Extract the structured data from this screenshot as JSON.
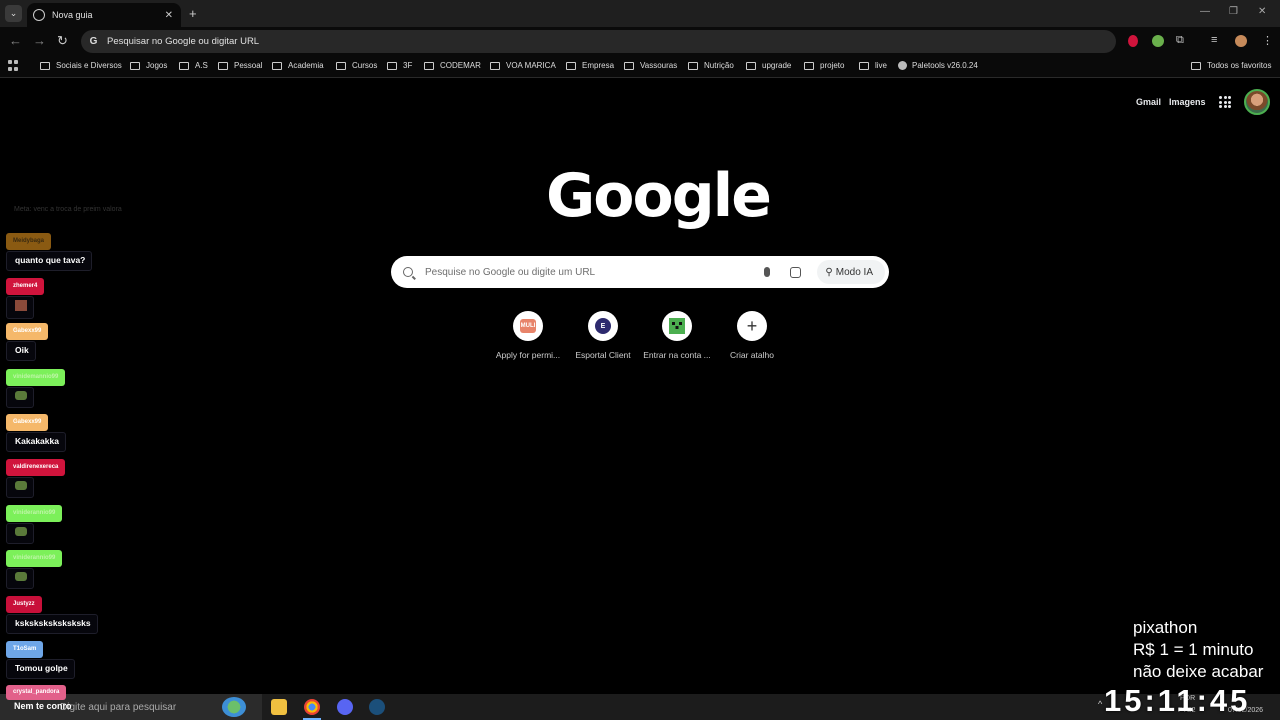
{
  "tab": {
    "title": "Nova guia",
    "close": "✕",
    "new": "+"
  },
  "window": {
    "minimize": "—",
    "restore": "❐",
    "close": "✕"
  },
  "toolbar": {
    "back": "←",
    "forward": "→",
    "reload": "↻",
    "omnibox_text": "Pesquisar no Google ou digitar URL",
    "menu": "⋮"
  },
  "bookmarks": {
    "items": [
      {
        "label": "Sociais e Diversos",
        "type": "folder"
      },
      {
        "label": "Jogos",
        "type": "folder"
      },
      {
        "label": "A.S",
        "type": "folder"
      },
      {
        "label": "Pessoal",
        "type": "folder"
      },
      {
        "label": "Academia",
        "type": "folder"
      },
      {
        "label": "Cursos",
        "type": "folder"
      },
      {
        "label": "3F",
        "type": "folder"
      },
      {
        "label": "CODEMAR",
        "type": "folder"
      },
      {
        "label": "VOA MARICA",
        "type": "folder"
      },
      {
        "label": "Empresa",
        "type": "folder"
      },
      {
        "label": "Vassouras",
        "type": "folder"
      },
      {
        "label": "Nutrição",
        "type": "folder"
      },
      {
        "label": "upgrade",
        "type": "folder"
      },
      {
        "label": "projeto",
        "type": "folder"
      },
      {
        "label": "live",
        "type": "folder"
      },
      {
        "label": "Paletools v26.0.24",
        "type": "site"
      }
    ],
    "all": "Todos os favoritos"
  },
  "header": {
    "gmail": "Gmail",
    "images": "Imagens"
  },
  "logo": "Google",
  "search": {
    "placeholder": "Pesquise no Google ou digite um URL",
    "ai_mode": "Modo IA"
  },
  "shortcuts": [
    {
      "label": "Apply for permi...",
      "icon": "muli-icon",
      "text": "MULI"
    },
    {
      "label": "Esportal Client",
      "icon": "esportal-icon",
      "text": "E"
    },
    {
      "label": "Entrar na conta ...",
      "icon": "creeper-icon",
      "text": ""
    },
    {
      "label": "Criar atalho",
      "icon": "plus-icon",
      "text": "+"
    }
  ],
  "chat": {
    "top_text": "Meta: venc a troca de preim valora",
    "messages": [
      {
        "user": "Meidybaga",
        "color": "#8a5a12",
        "text": "quanto que tava?"
      },
      {
        "user": "zhemer4",
        "color": "#d0143c",
        "text": ""
      },
      {
        "user": "Gabexx99",
        "color": "#f5b86a",
        "text": "Oik"
      },
      {
        "user": "vinidemannio99",
        "color": "#7cf05a",
        "text": ""
      },
      {
        "user": "Gabexx99",
        "color": "#f5b86a",
        "text": "Kakakakka"
      },
      {
        "user": "valdirenexereca",
        "color": "#d0143c",
        "text": ""
      },
      {
        "user": "viniderannio99",
        "color": "#7cf05a",
        "text": ""
      },
      {
        "user": "viniderannio99",
        "color": "#7cf05a",
        "text": ""
      },
      {
        "user": "Justyzz",
        "color": "#c8103a",
        "text": "ksksksksksksksks"
      },
      {
        "user": "T1oSam",
        "color": "#6ea6e8",
        "text": "Tomou golpe"
      },
      {
        "user": "crystal_pandora",
        "color": "#e2608a",
        "text": "Nem te conro"
      }
    ]
  },
  "overlay": {
    "line1": "pixathon",
    "line2": "R$ 1 = 1 minuto",
    "line3": "não deixe acabar",
    "clock": "15:11:45"
  },
  "taskbar": {
    "search_placeholder": "Digite aqui para pesquisar",
    "tray_lang": "POR",
    "tray_layout": "PTB2",
    "tray_date": "07/02/2026"
  }
}
